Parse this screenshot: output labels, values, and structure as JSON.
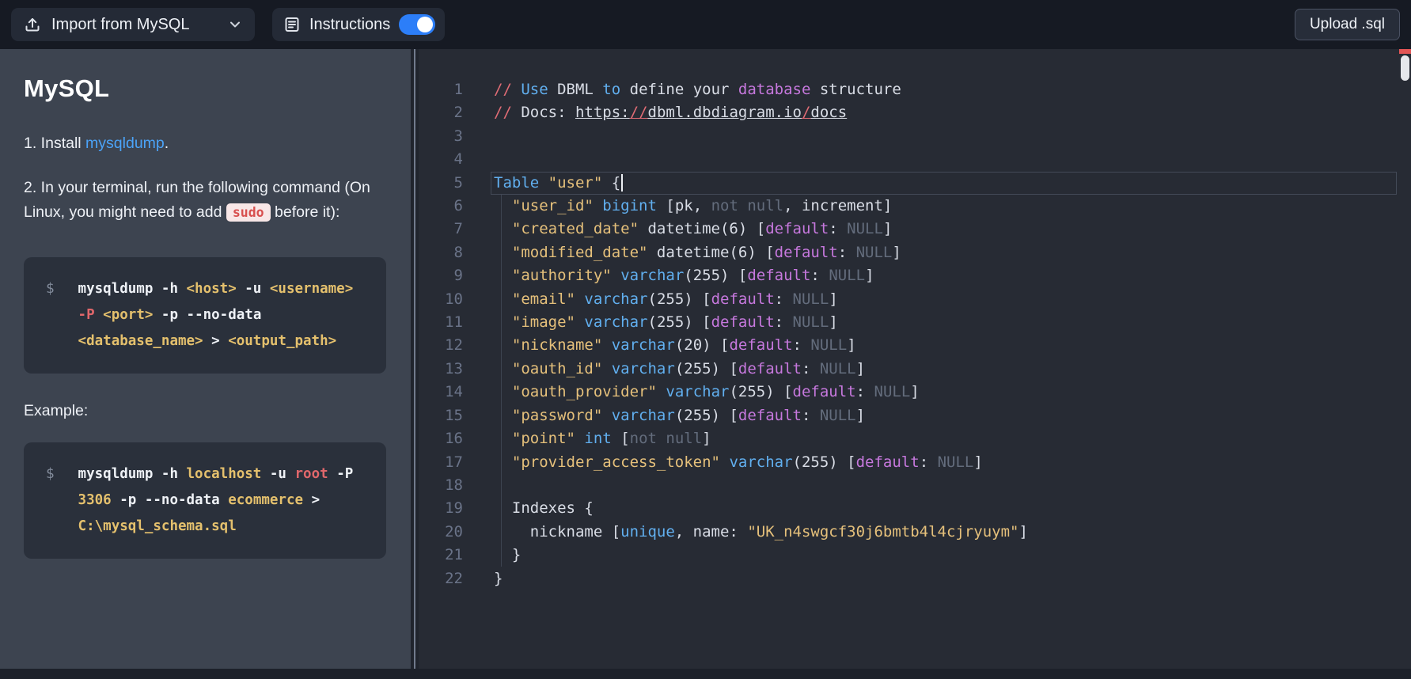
{
  "topbar": {
    "import_button": {
      "label": "Import from MySQL"
    },
    "instructions_button": {
      "label": "Instructions",
      "toggle_on": true
    },
    "upload_button": {
      "label": "Upload .sql"
    },
    "accent_blue": "#2c7ef8"
  },
  "sidebar": {
    "title": "MySQL",
    "step1_tokens": [
      {
        "t": "1. Install ",
        "c": "text"
      },
      {
        "t": "mysqldump",
        "c": "link"
      },
      {
        "t": ".",
        "c": "text"
      }
    ],
    "step2_tokens": [
      {
        "t": "2. In your terminal, run the following command (On Linux, you might need to add ",
        "c": "text"
      },
      {
        "t": "sudo",
        "c": "chip"
      },
      {
        "t": " before it):",
        "c": "text"
      }
    ],
    "command_block": {
      "prompt": "$",
      "lines": [
        [
          {
            "t": "mysqldump -h ",
            "c": "w"
          },
          {
            "t": "<host>",
            "c": "y"
          },
          {
            "t": " -u ",
            "c": "w"
          },
          {
            "t": "<username>",
            "c": "y"
          }
        ],
        [
          {
            "t": "-P",
            "c": "r"
          },
          {
            "t": " ",
            "c": "w"
          },
          {
            "t": "<port>",
            "c": "y"
          },
          {
            "t": " -p --no-data",
            "c": "w"
          }
        ],
        [
          {
            "t": "<database_name>",
            "c": "y"
          },
          {
            "t": " > ",
            "c": "w"
          },
          {
            "t": "<output_path>",
            "c": "y"
          }
        ]
      ]
    },
    "example_label": "Example:",
    "example_block": {
      "prompt": "$",
      "lines": [
        [
          {
            "t": "mysqldump -h ",
            "c": "w"
          },
          {
            "t": "localhost",
            "c": "y"
          },
          {
            "t": " -u ",
            "c": "w"
          },
          {
            "t": "root",
            "c": "r"
          },
          {
            "t": " -P",
            "c": "w"
          }
        ],
        [
          {
            "t": "3306",
            "c": "y"
          },
          {
            "t": " -p --no-data ",
            "c": "w"
          },
          {
            "t": "ecommerce",
            "c": "y"
          },
          {
            "t": " >",
            "c": "w"
          }
        ],
        [
          {
            "t": "C:\\mysql_schema.sql",
            "c": "y"
          }
        ]
      ]
    }
  },
  "editor": {
    "active_line": 5,
    "lines": [
      {
        "n": 1,
        "tokens": [
          {
            "t": "// ",
            "c": "r"
          },
          {
            "t": "Use",
            "c": "b"
          },
          {
            "t": " DBML ",
            "c": "w"
          },
          {
            "t": "to",
            "c": "b"
          },
          {
            "t": " define your ",
            "c": "w"
          },
          {
            "t": "database",
            "c": "m"
          },
          {
            "t": " structure",
            "c": "w"
          }
        ]
      },
      {
        "n": 2,
        "tokens": [
          {
            "t": "// ",
            "c": "r"
          },
          {
            "t": "Docs: ",
            "c": "w"
          },
          {
            "t": "https:",
            "c": "wu"
          },
          {
            "t": "//",
            "c": "ru"
          },
          {
            "t": "dbml.dbdiagram.io",
            "c": "wu"
          },
          {
            "t": "/",
            "c": "ru"
          },
          {
            "t": "docs",
            "c": "wu"
          }
        ]
      },
      {
        "n": 3,
        "tokens": []
      },
      {
        "n": 4,
        "tokens": []
      },
      {
        "n": 5,
        "cursor": true,
        "tokens": [
          {
            "t": "Table",
            "c": "b"
          },
          {
            "t": " ",
            "c": "w"
          },
          {
            "t": "\"user\"",
            "c": "y"
          },
          {
            "t": " {",
            "c": "w"
          }
        ]
      },
      {
        "n": 6,
        "tokens": [
          {
            "t": "  ",
            "c": "w"
          },
          {
            "t": "\"user_id\"",
            "c": "y"
          },
          {
            "t": " ",
            "c": "w"
          },
          {
            "t": "bigint",
            "c": "b"
          },
          {
            "t": " [pk, ",
            "c": "w"
          },
          {
            "t": "not null",
            "c": "g"
          },
          {
            "t": ", increment]",
            "c": "w"
          }
        ]
      },
      {
        "n": 7,
        "tokens": [
          {
            "t": "  ",
            "c": "w"
          },
          {
            "t": "\"created_date\"",
            "c": "y"
          },
          {
            "t": " datetime(6) [",
            "c": "w"
          },
          {
            "t": "default",
            "c": "m"
          },
          {
            "t": ": ",
            "c": "w"
          },
          {
            "t": "NULL",
            "c": "g"
          },
          {
            "t": "]",
            "c": "w"
          }
        ]
      },
      {
        "n": 8,
        "tokens": [
          {
            "t": "  ",
            "c": "w"
          },
          {
            "t": "\"modified_date\"",
            "c": "y"
          },
          {
            "t": " datetime(6) [",
            "c": "w"
          },
          {
            "t": "default",
            "c": "m"
          },
          {
            "t": ": ",
            "c": "w"
          },
          {
            "t": "NULL",
            "c": "g"
          },
          {
            "t": "]",
            "c": "w"
          }
        ]
      },
      {
        "n": 9,
        "tokens": [
          {
            "t": "  ",
            "c": "w"
          },
          {
            "t": "\"authority\"",
            "c": "y"
          },
          {
            "t": " ",
            "c": "w"
          },
          {
            "t": "varchar",
            "c": "b"
          },
          {
            "t": "(255) [",
            "c": "w"
          },
          {
            "t": "default",
            "c": "m"
          },
          {
            "t": ": ",
            "c": "w"
          },
          {
            "t": "NULL",
            "c": "g"
          },
          {
            "t": "]",
            "c": "w"
          }
        ]
      },
      {
        "n": 10,
        "tokens": [
          {
            "t": "  ",
            "c": "w"
          },
          {
            "t": "\"email\"",
            "c": "y"
          },
          {
            "t": " ",
            "c": "w"
          },
          {
            "t": "varchar",
            "c": "b"
          },
          {
            "t": "(255) [",
            "c": "w"
          },
          {
            "t": "default",
            "c": "m"
          },
          {
            "t": ": ",
            "c": "w"
          },
          {
            "t": "NULL",
            "c": "g"
          },
          {
            "t": "]",
            "c": "w"
          }
        ]
      },
      {
        "n": 11,
        "tokens": [
          {
            "t": "  ",
            "c": "w"
          },
          {
            "t": "\"image\"",
            "c": "y"
          },
          {
            "t": " ",
            "c": "w"
          },
          {
            "t": "varchar",
            "c": "b"
          },
          {
            "t": "(255) [",
            "c": "w"
          },
          {
            "t": "default",
            "c": "m"
          },
          {
            "t": ": ",
            "c": "w"
          },
          {
            "t": "NULL",
            "c": "g"
          },
          {
            "t": "]",
            "c": "w"
          }
        ]
      },
      {
        "n": 12,
        "tokens": [
          {
            "t": "  ",
            "c": "w"
          },
          {
            "t": "\"nickname\"",
            "c": "y"
          },
          {
            "t": " ",
            "c": "w"
          },
          {
            "t": "varchar",
            "c": "b"
          },
          {
            "t": "(20) [",
            "c": "w"
          },
          {
            "t": "default",
            "c": "m"
          },
          {
            "t": ": ",
            "c": "w"
          },
          {
            "t": "NULL",
            "c": "g"
          },
          {
            "t": "]",
            "c": "w"
          }
        ]
      },
      {
        "n": 13,
        "tokens": [
          {
            "t": "  ",
            "c": "w"
          },
          {
            "t": "\"oauth_id\"",
            "c": "y"
          },
          {
            "t": " ",
            "c": "w"
          },
          {
            "t": "varchar",
            "c": "b"
          },
          {
            "t": "(255) [",
            "c": "w"
          },
          {
            "t": "default",
            "c": "m"
          },
          {
            "t": ": ",
            "c": "w"
          },
          {
            "t": "NULL",
            "c": "g"
          },
          {
            "t": "]",
            "c": "w"
          }
        ]
      },
      {
        "n": 14,
        "tokens": [
          {
            "t": "  ",
            "c": "w"
          },
          {
            "t": "\"oauth_provider\"",
            "c": "y"
          },
          {
            "t": " ",
            "c": "w"
          },
          {
            "t": "varchar",
            "c": "b"
          },
          {
            "t": "(255) [",
            "c": "w"
          },
          {
            "t": "default",
            "c": "m"
          },
          {
            "t": ": ",
            "c": "w"
          },
          {
            "t": "NULL",
            "c": "g"
          },
          {
            "t": "]",
            "c": "w"
          }
        ]
      },
      {
        "n": 15,
        "tokens": [
          {
            "t": "  ",
            "c": "w"
          },
          {
            "t": "\"password\"",
            "c": "y"
          },
          {
            "t": " ",
            "c": "w"
          },
          {
            "t": "varchar",
            "c": "b"
          },
          {
            "t": "(255) [",
            "c": "w"
          },
          {
            "t": "default",
            "c": "m"
          },
          {
            "t": ": ",
            "c": "w"
          },
          {
            "t": "NULL",
            "c": "g"
          },
          {
            "t": "]",
            "c": "w"
          }
        ]
      },
      {
        "n": 16,
        "tokens": [
          {
            "t": "  ",
            "c": "w"
          },
          {
            "t": "\"point\"",
            "c": "y"
          },
          {
            "t": " ",
            "c": "w"
          },
          {
            "t": "int",
            "c": "b"
          },
          {
            "t": " [",
            "c": "w"
          },
          {
            "t": "not null",
            "c": "g"
          },
          {
            "t": "]",
            "c": "w"
          }
        ]
      },
      {
        "n": 17,
        "tokens": [
          {
            "t": "  ",
            "c": "w"
          },
          {
            "t": "\"provider_access_token\"",
            "c": "y"
          },
          {
            "t": " ",
            "c": "w"
          },
          {
            "t": "varchar",
            "c": "b"
          },
          {
            "t": "(255) [",
            "c": "w"
          },
          {
            "t": "default",
            "c": "m"
          },
          {
            "t": ": ",
            "c": "w"
          },
          {
            "t": "NULL",
            "c": "g"
          },
          {
            "t": "]",
            "c": "w"
          }
        ]
      },
      {
        "n": 18,
        "tokens": []
      },
      {
        "n": 19,
        "tokens": [
          {
            "t": "  Indexes {",
            "c": "w"
          }
        ]
      },
      {
        "n": 20,
        "tokens": [
          {
            "t": "    nickname [",
            "c": "w"
          },
          {
            "t": "unique",
            "c": "b"
          },
          {
            "t": ", name: ",
            "c": "w"
          },
          {
            "t": "\"UK_n4swgcf30j6bmtb4l4cjryuym\"",
            "c": "y"
          },
          {
            "t": "]",
            "c": "w"
          }
        ]
      },
      {
        "n": 21,
        "tokens": [
          {
            "t": "  }",
            "c": "w"
          }
        ]
      },
      {
        "n": 22,
        "tokens": [
          {
            "t": "}",
            "c": "w"
          }
        ]
      }
    ]
  }
}
